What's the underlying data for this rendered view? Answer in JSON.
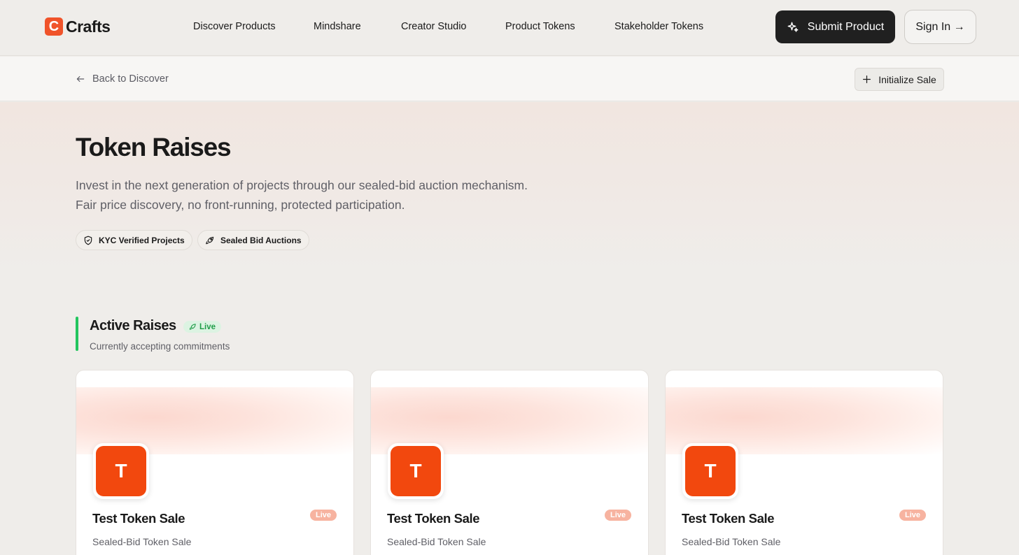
{
  "brand": {
    "logo_letter": "C",
    "name": "Crafts"
  },
  "nav": {
    "items": [
      {
        "label": "Discover Products"
      },
      {
        "label": "Mindshare"
      },
      {
        "label": "Creator Studio"
      },
      {
        "label": "Product Tokens"
      },
      {
        "label": "Stakeholder Tokens"
      }
    ],
    "submit_label": "Submit Product",
    "signin_label": "Sign In →"
  },
  "subbar": {
    "back_label": "Back to Discover",
    "init_label": "Initialize Sale"
  },
  "hero": {
    "title": "Token Raises",
    "description_line1": "Invest in the next generation of projects through our sealed-bid auction mechanism.",
    "description_line2": "Fair price discovery, no front-running, protected participation.",
    "chips": [
      {
        "label": "KYC Verified Projects",
        "icon": "shield-icon"
      },
      {
        "label": "Sealed Bid Auctions",
        "icon": "rocket-icon"
      }
    ]
  },
  "active_raises": {
    "title": "Active Raises",
    "badge": "Live",
    "subtitle": "Currently accepting commitments",
    "accent_color": "#22c55e"
  },
  "cards": [
    {
      "avatar_letter": "T",
      "title": "Test Token Sale",
      "status": "Live",
      "subtitle": "Sealed-Bid Token Sale"
    },
    {
      "avatar_letter": "T",
      "title": "Test Token Sale",
      "status": "Live",
      "subtitle": "Sealed-Bid Token Sale"
    },
    {
      "avatar_letter": "T",
      "title": "Test Token Sale",
      "status": "Live",
      "subtitle": "Sealed-Bid Token Sale"
    }
  ],
  "colors": {
    "brand": "#f0532a",
    "avatar": "#f2480e",
    "live_green": "#1f9d48",
    "card_live": "#f7b3a0"
  }
}
